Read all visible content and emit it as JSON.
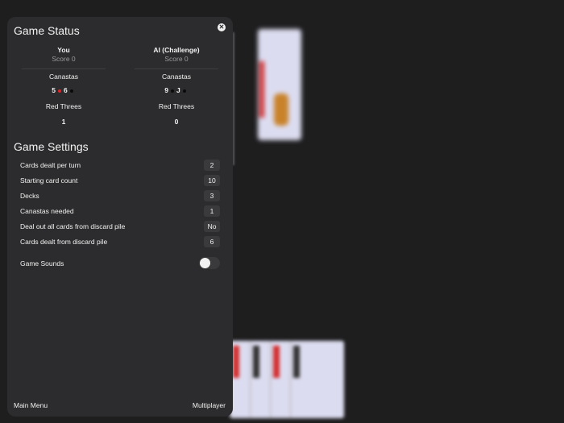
{
  "status": {
    "title": "Game Status",
    "players": [
      {
        "name": "You",
        "score": "Score 0",
        "canastas": [
          "5",
          "6"
        ],
        "canasta_colors": [
          "red",
          "black"
        ],
        "red_threes": "1"
      },
      {
        "name": "AI (Challenge)",
        "score": "Score 0",
        "canastas": [
          "9",
          "J"
        ],
        "canasta_colors": [
          "black",
          "black"
        ],
        "red_threes": "0"
      }
    ],
    "canastas_label": "Canastas",
    "red_threes_label": "Red Threes"
  },
  "settings": {
    "title": "Game Settings",
    "items": [
      {
        "label": "Cards dealt per turn",
        "value": "2"
      },
      {
        "label": "Starting card count",
        "value": "10"
      },
      {
        "label": "Decks",
        "value": "3"
      },
      {
        "label": "Canastas needed",
        "value": "1"
      },
      {
        "label": "Deal out all cards from discard pile",
        "value": "No"
      },
      {
        "label": "Cards dealt from discard pile",
        "value": "6"
      }
    ],
    "sounds_label": "Game Sounds",
    "sounds_on": false
  },
  "footer": {
    "main_menu": "Main Menu",
    "multiplayer": "Multiplayer"
  },
  "icons": {
    "close": "close-icon"
  },
  "colors": {
    "panel": "#2c2c2e",
    "background": "#1e1e1f",
    "badge": "#3a3a3c",
    "red_dot": "#e02424"
  }
}
